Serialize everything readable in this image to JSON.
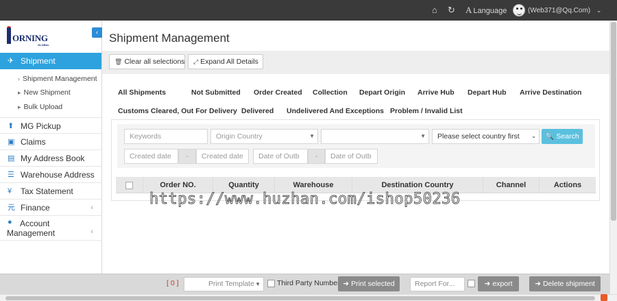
{
  "topbar": {
    "language": "Language",
    "user": "(Web371@Qq.Com)"
  },
  "logo": {
    "text": "ORNING",
    "sub": "GLOBAL"
  },
  "sidebar": {
    "items": [
      {
        "label": "Shipment",
        "icon": "plane-icon"
      },
      {
        "label": "MG Pickup",
        "icon": "upload-icon"
      },
      {
        "label": "Claims",
        "icon": "money-icon"
      },
      {
        "label": "My Address Book",
        "icon": "address-card-icon"
      },
      {
        "label": "Warehouse Address",
        "icon": "list-icon"
      },
      {
        "label": "Tax Statement",
        "icon": "yen-icon"
      },
      {
        "label": "Finance",
        "icon": "yuan-icon"
      },
      {
        "label": "Account Management",
        "icon": "user-icon"
      }
    ],
    "subitems": [
      "Shipment Management",
      "New Shipment",
      "Bulk Upload"
    ]
  },
  "main": {
    "title": "Shipment Management",
    "clear_label": "Clear all selections",
    "expand_label": "Expand All Details",
    "tabs": [
      "All Shipments",
      "Not Submitted",
      "Order Created",
      "Collection",
      "Depart Origin",
      "Arrive Hub",
      "Depart Hub",
      "Arrive Destination",
      "Customs Cleared, Out For Delivery",
      "Delivered",
      "Undelivered And Exceptions",
      "Problem / Invalid List"
    ],
    "filters": {
      "keywords": "Keywords",
      "origin_country": "Origin Country",
      "country_select": "Please select country first",
      "search": "Search",
      "created_date_1": "Created date",
      "created_date_2": "Created date",
      "outbound_1": "Date of Outb",
      "outbound_2": "Date of Outb",
      "dash": "-"
    },
    "columns": [
      "Order NO.",
      "Quantity",
      "Warehouse",
      "Destination Country",
      "Channel",
      "Actions"
    ]
  },
  "watermark": "https://www.huzhan.com/ishop50236",
  "bottom": {
    "count_open": "[",
    "count": "0",
    "count_close": "]",
    "print_template": "Print Template",
    "third_party": "Third Party Number",
    "print_selected": "Print selected",
    "report_format": "Report For...",
    "export": "export",
    "delete": "Delete shipment"
  },
  "colors": {
    "accent": "#2ea2df",
    "topbar": "#3a3a3a",
    "search": "#5bc0de",
    "gray_button": "#8a8a8a"
  }
}
